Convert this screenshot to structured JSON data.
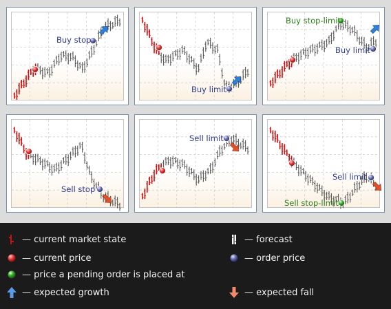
{
  "panels": [
    {
      "id": "buy-stop",
      "labels": [
        {
          "key": "buy_stop",
          "text": "Buy stop",
          "color": "#2e3a8c"
        }
      ]
    },
    {
      "id": "buy-limit",
      "labels": [
        {
          "key": "buy_limit",
          "text": "Buy limit",
          "color": "#2e3a8c"
        }
      ]
    },
    {
      "id": "buy-stop-limit",
      "labels": [
        {
          "key": "buy_stop_limit",
          "text": "Buy stop-limit",
          "color": "#2e7d1a"
        },
        {
          "key": "buy_limit",
          "text": "Buy limit",
          "color": "#2e3a8c"
        }
      ]
    },
    {
      "id": "sell-stop",
      "labels": [
        {
          "key": "sell_stop",
          "text": "Sell stop",
          "color": "#2e3a8c"
        }
      ]
    },
    {
      "id": "sell-limit",
      "labels": [
        {
          "key": "sell_limit",
          "text": "Sell limit",
          "color": "#2e3a8c"
        }
      ]
    },
    {
      "id": "sell-stop-limit",
      "labels": [
        {
          "key": "sell_limit",
          "text": "Sell limit",
          "color": "#2e3a8c"
        },
        {
          "key": "sell_stop_limit",
          "text": "Sell stop-limit",
          "color": "#2e7d1a"
        }
      ]
    }
  ],
  "legend": {
    "current_market_state": "— current market state",
    "forecast": "— forecast",
    "current_price": "— current price",
    "order_price": "— order price",
    "pending_price": "— price a pending order is placed at",
    "expected_growth": "— expected growth",
    "expected_fall": "— expected fall"
  },
  "colors": {
    "market_bars": "#cc1111",
    "forecast_bars": "#555555",
    "current_price_dot": "#e23a3a",
    "order_price_dot": "#4a4f8a",
    "pending_dot": "#3aa82a",
    "growth_arrow": "#2f7fd6",
    "fall_arrow": "#e0502a"
  },
  "icons": [
    "market-bar-icon",
    "forecast-bar-icon",
    "red-dot-icon",
    "blue-dot-icon",
    "green-dot-icon",
    "up-arrow-icon",
    "down-arrow-icon"
  ]
}
